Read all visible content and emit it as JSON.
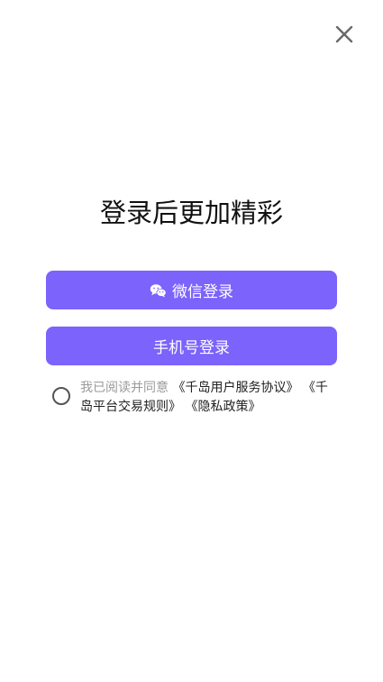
{
  "close": {
    "icon": "close-icon"
  },
  "title": "登录后更加精彩",
  "buttons": {
    "wechat_label": "微信登录",
    "wechat_icon": "wechat-icon",
    "phone_label": "手机号登录"
  },
  "agreement": {
    "prefix": "我已阅读并同意",
    "links": [
      "《千岛用户服务协议》",
      "《千岛平台交易规则》",
      "《隐私政策》"
    ],
    "checked": false
  },
  "colors": {
    "accent": "#7b63fb",
    "background": "#ffffff",
    "muted_text": "#9a9a9a"
  }
}
